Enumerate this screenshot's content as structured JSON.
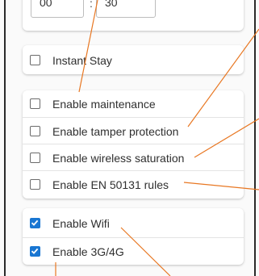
{
  "time": {
    "hours": "00",
    "separator": ":",
    "minutes": "30"
  },
  "instant_stay": {
    "label": "Instant Stay",
    "checked": false
  },
  "settings_group": [
    {
      "label": "Enable maintenance",
      "checked": false
    },
    {
      "label": "Enable tamper protection",
      "checked": false
    },
    {
      "label": "Enable wireless saturation",
      "checked": false
    },
    {
      "label": "Enable EN 50131 rules",
      "checked": false
    }
  ],
  "connectivity_group": [
    {
      "label": "Enable Wifi",
      "checked": true
    },
    {
      "label": "Enable 3G/4G",
      "checked": true
    }
  ],
  "colors": {
    "accent": "#1976d2",
    "annotation_line": "#e87722",
    "frame": "#2a2a2a"
  }
}
